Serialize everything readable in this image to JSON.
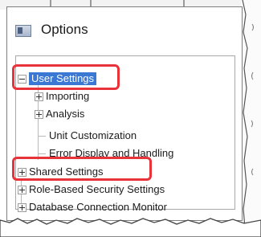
{
  "dialog": {
    "title": "Options"
  },
  "tree": {
    "items": [
      {
        "label": "User Settings",
        "selected": true,
        "expander": "minus"
      },
      {
        "label": "Importing",
        "expander": "plus"
      },
      {
        "label": "Analysis",
        "expander": "plus"
      },
      {
        "label": "Unit Customization",
        "expander": "none"
      },
      {
        "label": "Error Display and Handling",
        "expander": "none"
      },
      {
        "label": "Shared Settings",
        "expander": "plus"
      },
      {
        "label": "Role-Based Security Settings",
        "expander": "plus"
      },
      {
        "label": "Database Connection Monitor",
        "expander": "plus"
      }
    ]
  },
  "colors": {
    "selection": "#3a78d4",
    "highlight": "#e8333b"
  }
}
